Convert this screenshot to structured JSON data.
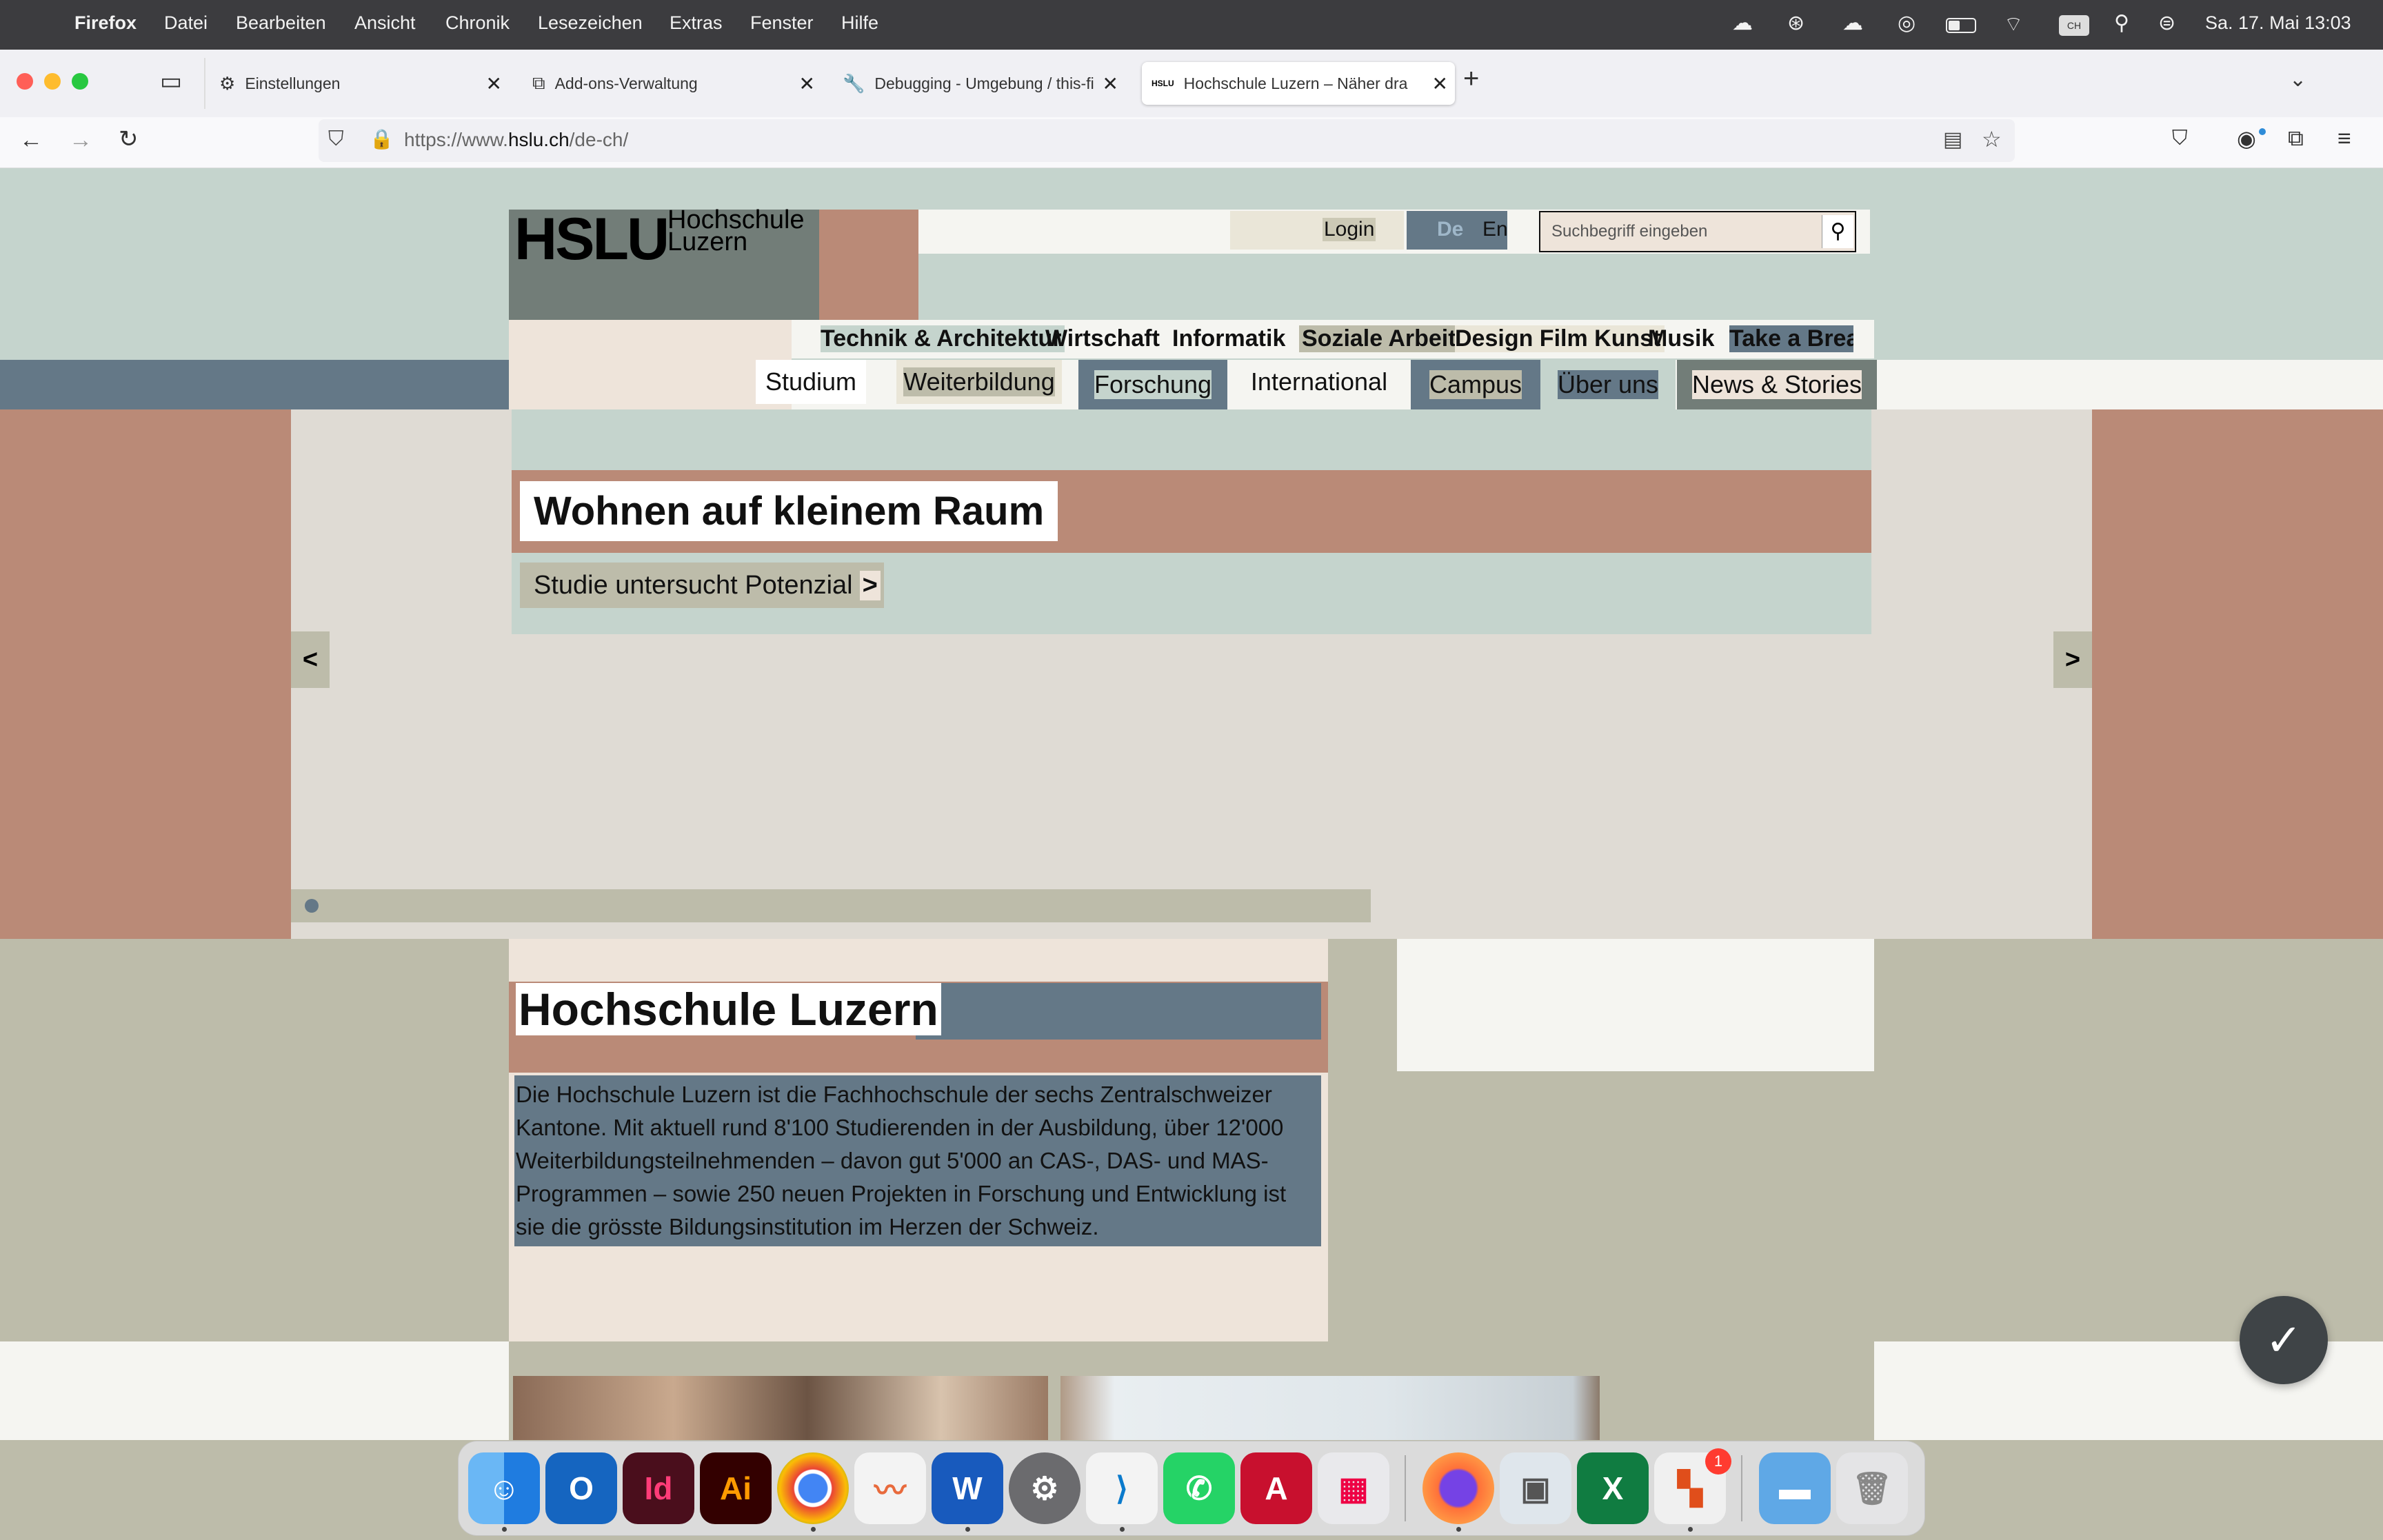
{
  "menubar": {
    "app": "Firefox",
    "items": [
      "Datei",
      "Bearbeiten",
      "Ansicht",
      "Chronik",
      "Lesezeichen",
      "Extras",
      "Fenster",
      "Hilfe"
    ],
    "datetime": "Sa. 17. Mai  13:03"
  },
  "tabs": [
    {
      "label": "Einstellungen",
      "icon": "gear-icon"
    },
    {
      "label": "Add-ons-Verwaltung",
      "icon": "puzzle-icon"
    },
    {
      "label": "Debugging - Umgebung / this-fi",
      "icon": "wrench-icon"
    },
    {
      "label": "Hochschule Luzern – Näher dra",
      "icon": "hslu-favicon"
    }
  ],
  "urlbar": {
    "prefix": "https://www.",
    "host": "hslu.ch",
    "path": "/de-ch/"
  },
  "site": {
    "logo_mark": "HSLU",
    "logo_line1": "Hochschule",
    "logo_line2": "Luzern",
    "login": "Login",
    "lang_de": "De",
    "lang_en": "En",
    "search_placeholder": "Suchbegriff eingeben",
    "departments": [
      "Technik & Architektur",
      "Wirtschaft",
      "Informatik",
      "Soziale Arbeit",
      "Design Film Kunst",
      "Musik",
      "Take a Break!"
    ],
    "main_nav": [
      "Studium",
      "Weiterbildung",
      "Forschung",
      "International",
      "Campus",
      "Über uns",
      "News & Stories"
    ]
  },
  "hero": {
    "title": "Wohnen auf kleinem Raum",
    "cta": "Studie untersucht Potenzial",
    "cta_arrow": ">",
    "prev": "<",
    "next": ">"
  },
  "intro": {
    "title": "Hochschule Luzern",
    "text": "Die Hochschule Luzern ist die Fachhochschule der sechs Zentralschweizer Kantone. Mit aktuell rund 8'100 Studierenden in der Ausbildung, über 12'000 Weiterbildungsteilnehmenden – davon gut 5'000 an CAS-, DAS- und MAS-Programmen – sowie 250 neuen Projekten in Forschung und Entwicklung ist sie die grösste Bildungsinstitution im Herzen der Schweiz."
  },
  "dock": {
    "apps": [
      "Finder",
      "Outlook",
      "InDesign",
      "Illustrator",
      "Chrome",
      "Freeform",
      "Word",
      "Systemeinstellungen",
      "VS Code",
      "WhatsApp",
      "Acrobat",
      "Launchpad",
      "Firefox",
      "Vorschau",
      "Excel",
      "Microsoft 365",
      "Ordner",
      "Papierkorb"
    ],
    "badge": "1"
  },
  "colors": {
    "salmon": "#ba8a77",
    "slate": "#647887",
    "sage": "#c5d4cd",
    "khaki": "#bdbcaa",
    "cream": "#eee4da",
    "light": "#f5f5f1"
  }
}
